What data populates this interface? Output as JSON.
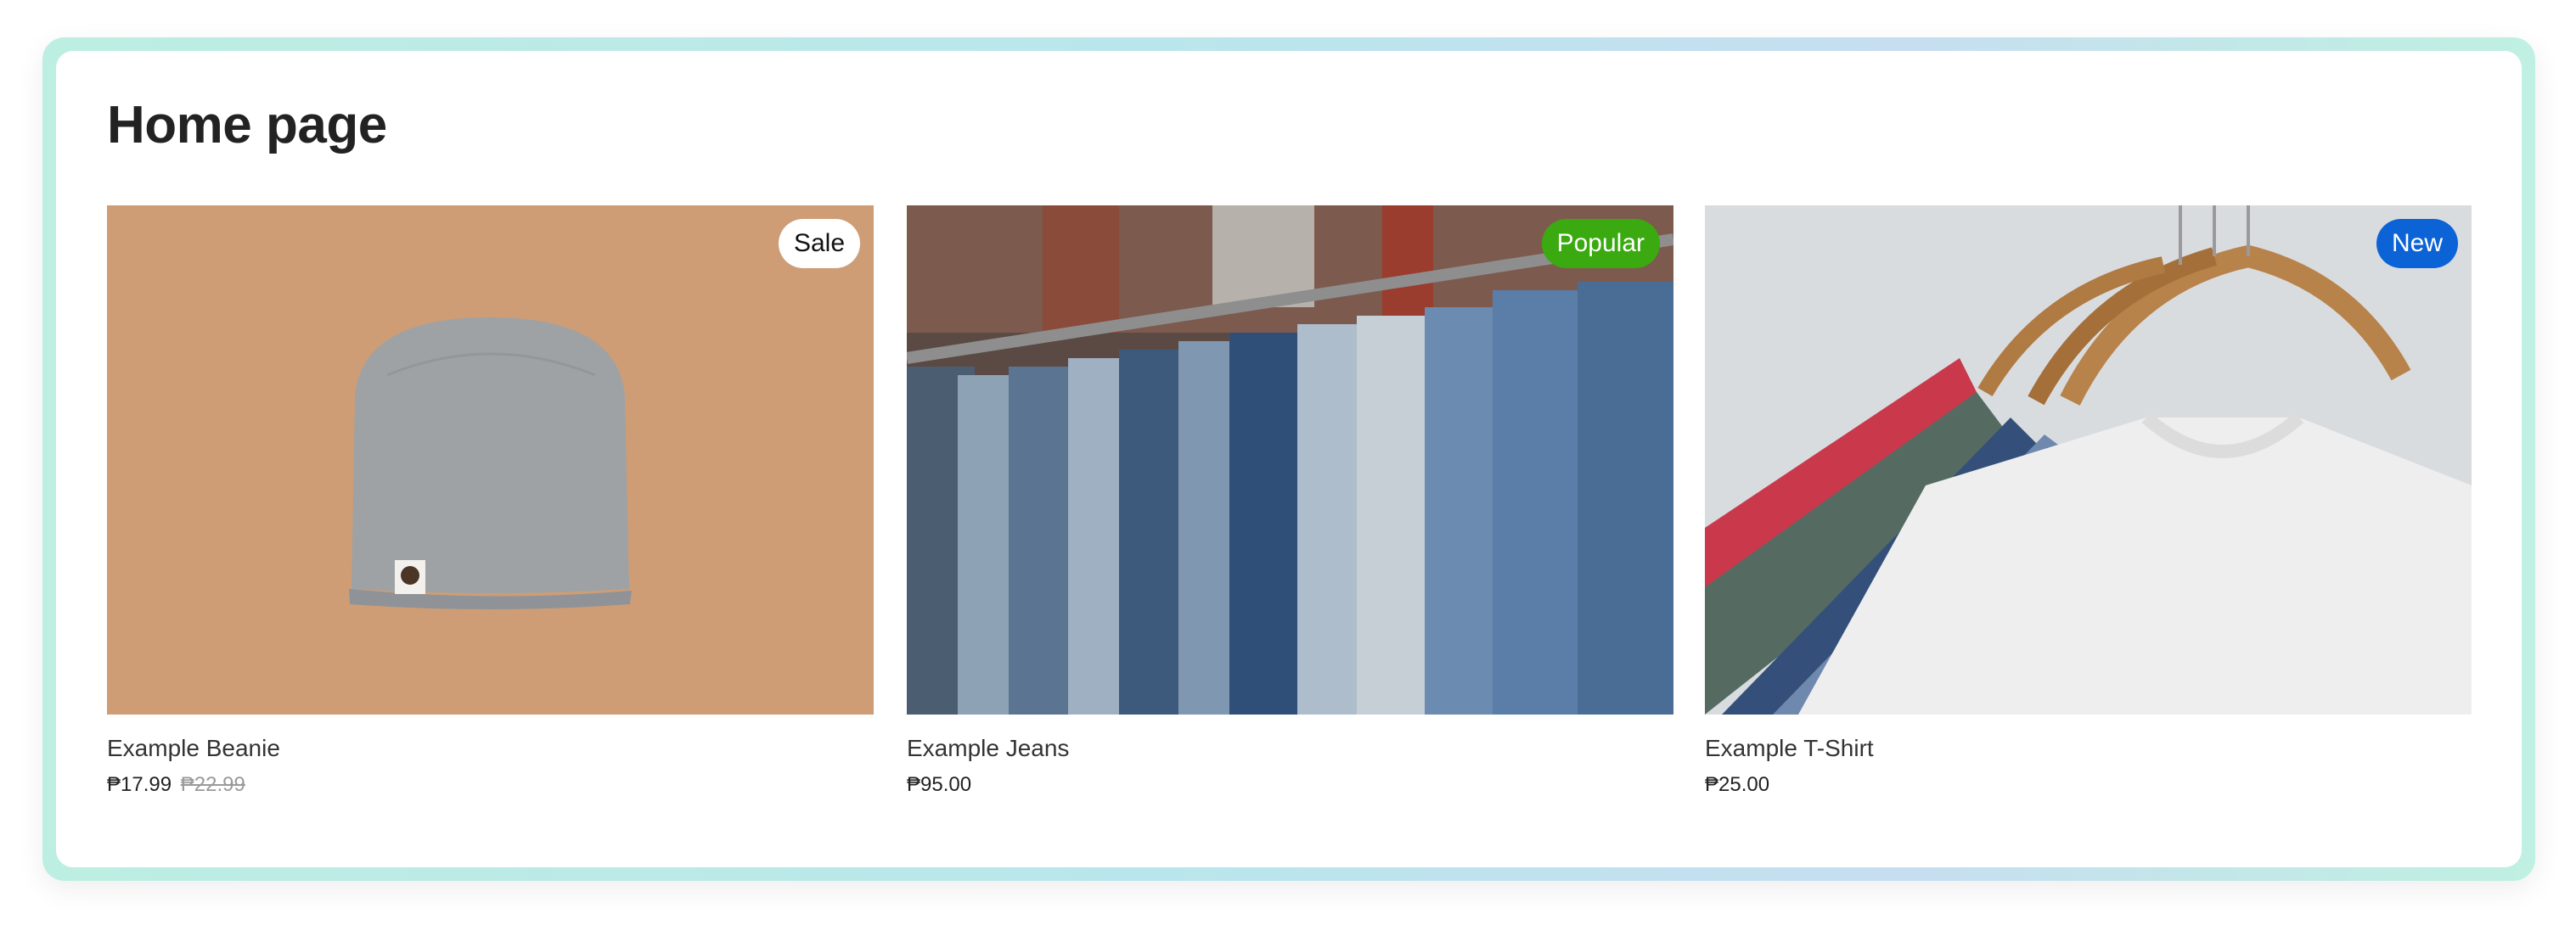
{
  "page": {
    "title": "Home page"
  },
  "products": [
    {
      "name": "Example Beanie",
      "price": "₱17.99",
      "compare_price": "₱22.99",
      "badge": "Sale",
      "image_subject": "grey beanie on tan surface"
    },
    {
      "name": "Example Jeans",
      "price": "₱95.00",
      "badge": "Popular",
      "image_subject": "denim jeans hanging on rail"
    },
    {
      "name": "Example T-Shirt",
      "price": "₱25.00",
      "badge": "New",
      "image_subject": "t-shirts on wooden hangers"
    }
  ],
  "colors": {
    "badge_sale_bg": "#ffffff",
    "badge_popular_bg": "#3aaa10",
    "badge_new_bg": "#0b63d6",
    "frame_gradient": [
      "#bdeee2",
      "#c6def0"
    ]
  }
}
